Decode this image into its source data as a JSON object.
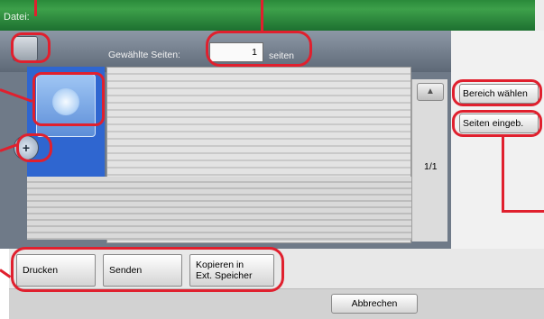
{
  "header": {
    "title": "Datei:"
  },
  "toolbar": {
    "pages_label": "Gewählte Seiten:",
    "pages_value": "1",
    "pages_unit": "seiten"
  },
  "preview": {
    "page_count": "1/1"
  },
  "side_buttons": {
    "select_range": "Bereich wählen",
    "enter_pages": "Seiten eingeb."
  },
  "actions": {
    "print": "Drucken",
    "send": "Senden",
    "copy_external": "Kopieren in\nExt. Speicher"
  },
  "footer": {
    "cancel": "Abbrechen"
  },
  "icons": {
    "select_all": "checkbox-icon",
    "thumbnail": "document-thumbnail-icon",
    "zoom": "zoom-icon",
    "scroll_up": "scroll-up-icon"
  },
  "colors": {
    "header": "#2a8a3a",
    "highlight": "#e0202e",
    "thumbnail_bg": "#2f66d0"
  }
}
